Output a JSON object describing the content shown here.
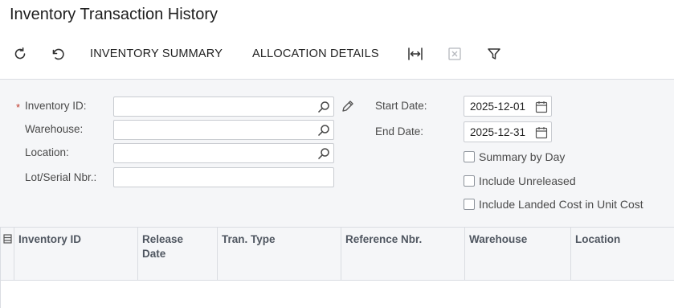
{
  "page": {
    "title": "Inventory Transaction History"
  },
  "toolbar": {
    "refresh_icon": "refresh-icon",
    "undo_icon": "undo-icon",
    "inventory_summary": "INVENTORY SUMMARY",
    "allocation_details": "ALLOCATION DETAILS",
    "fit_columns_icon": "fit-columns-icon",
    "export_excel_icon": "export-excel-icon",
    "filter_icon": "filter-icon"
  },
  "filters": {
    "inventory_id": {
      "label": "Inventory ID:",
      "required_mark": "*",
      "value": ""
    },
    "warehouse": {
      "label": "Warehouse:",
      "value": ""
    },
    "location": {
      "label": "Location:",
      "value": ""
    },
    "lot_serial": {
      "label": "Lot/Serial Nbr.:",
      "value": ""
    },
    "start_date": {
      "label": "Start Date:",
      "value": "2025-12-01"
    },
    "end_date": {
      "label": "End Date:",
      "value": "2025-12-31"
    },
    "summary_by_day": {
      "label": "Summary by Day",
      "checked": false
    },
    "include_unreleased": {
      "label": "Include Unreleased",
      "checked": false
    },
    "include_landed_cost": {
      "label": "Include Landed Cost in Unit Cost",
      "checked": false
    }
  },
  "grid": {
    "columns": [
      {
        "label_line1": "Inventory ID",
        "label_line2": ""
      },
      {
        "label_line1": "Release",
        "label_line2": "Date"
      },
      {
        "label_line1": "Tran. Type",
        "label_line2": ""
      },
      {
        "label_line1": "Reference Nbr.",
        "label_line2": ""
      },
      {
        "label_line1": "Warehouse",
        "label_line2": ""
      },
      {
        "label_line1": "Location",
        "label_line2": ""
      }
    ],
    "rows": []
  },
  "colors": {
    "panel_bg": "#f5f6f8",
    "border": "#dadde2",
    "required": "#c0392b"
  }
}
